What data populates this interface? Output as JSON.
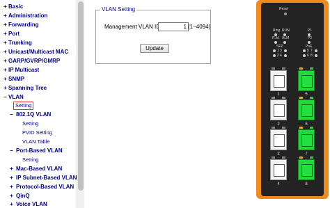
{
  "nav": {
    "items": [
      {
        "exp": "+",
        "label": "Basic",
        "level": 0
      },
      {
        "exp": "+",
        "label": "Administration",
        "level": 0
      },
      {
        "exp": "+",
        "label": "Forwarding",
        "level": 0
      },
      {
        "exp": "+",
        "label": "Port",
        "level": 0
      },
      {
        "exp": "+",
        "label": "Trunking",
        "level": 0
      },
      {
        "exp": "+",
        "label": "Unicast/Multicast MAC",
        "level": 0
      },
      {
        "exp": "+",
        "label": "GARP/GVRP/GMRP",
        "level": 0
      },
      {
        "exp": "+",
        "label": "IP Multicast",
        "level": 0
      },
      {
        "exp": "+",
        "label": "SNMP",
        "level": 0
      },
      {
        "exp": "+",
        "label": "Spanning Tree",
        "level": 0
      },
      {
        "exp": "−",
        "label": "VLAN",
        "level": 0
      },
      {
        "exp": "",
        "label": "Setting",
        "level": 2,
        "selected": true
      },
      {
        "exp": "−",
        "label": "802.1Q VLAN",
        "level": 1
      },
      {
        "exp": "",
        "label": "Setting",
        "level": 2
      },
      {
        "exp": "",
        "label": "PVID Setting",
        "level": 2
      },
      {
        "exp": "",
        "label": "VLAN Table",
        "level": 2
      },
      {
        "exp": "−",
        "label": "Port-Based VLAN",
        "level": 1
      },
      {
        "exp": "",
        "label": "Setting",
        "level": 2
      },
      {
        "exp": "+",
        "label": "Mac-Based VLAN",
        "level": 1
      },
      {
        "exp": "+",
        "label": "IP Subnet-Based VLAN",
        "level": 1
      },
      {
        "exp": "+",
        "label": "Protocol-Based VLAN",
        "level": 1
      },
      {
        "exp": "+",
        "label": "QinQ",
        "level": 1
      },
      {
        "exp": "+",
        "label": "Voice VLAN",
        "level": 1
      }
    ]
  },
  "vlan_setting": {
    "legend": "VLAN Setting",
    "mgmt_label": "Management VLAN ID",
    "mgmt_value": "1",
    "range": "(1~4094)",
    "apply_label": "Update"
  },
  "panel": {
    "reset": "Reset",
    "ring": "Ring",
    "run": "RUN",
    "rm": "R.M.",
    "alm": "ALM",
    "p1": "P1",
    "p2": "P2",
    "sfp": "SFP",
    "poe": "PoE",
    "sfp_led_1": "1",
    "sfp_led_3": "3",
    "sfp_led_2": "2",
    "sfp_led_4": "4",
    "poe_led_5": "5",
    "poe_led_7": "7",
    "poe_led_6": "6",
    "poe_led_8": "8",
    "ports": [
      {
        "num": "1",
        "status": "down"
      },
      {
        "num": "5",
        "status": "up"
      },
      {
        "num": "2",
        "status": "down"
      },
      {
        "num": "6",
        "status": "up"
      },
      {
        "num": "3",
        "status": "down"
      },
      {
        "num": "7",
        "status": "up"
      },
      {
        "num": "4",
        "status": "down"
      },
      {
        "num": "8",
        "status": "up"
      }
    ],
    "colors": {
      "frame": "#f08a1c",
      "link_up": "#21d93a",
      "body": "#232323"
    }
  }
}
